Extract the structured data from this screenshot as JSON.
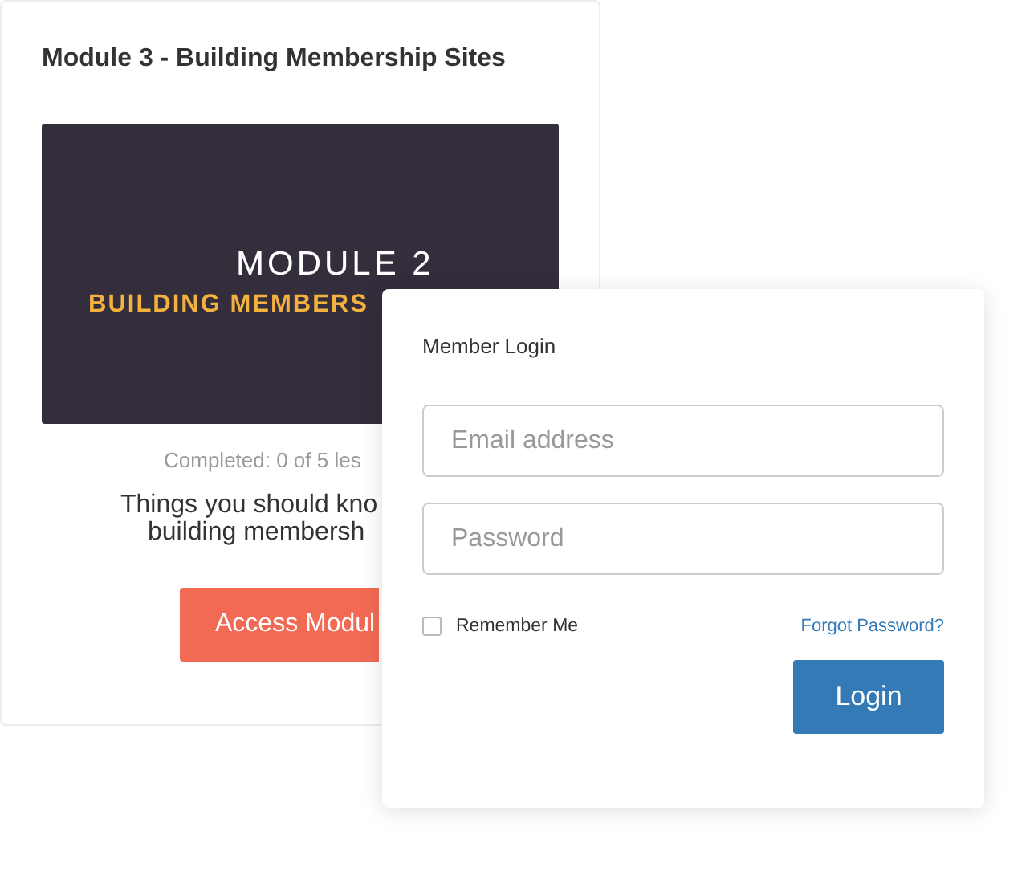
{
  "module_card": {
    "title": "Module 3 - Building Membership Sites",
    "banner": {
      "line_1": "MODULE 2",
      "line_2": "BUILDING MEMBERS"
    },
    "progress": "Completed: 0 of 5 les",
    "description": [
      "Things you should kno",
      "building membersh"
    ],
    "button": "Access Modul"
  },
  "login": {
    "title": "Member Login",
    "email": {
      "placeholder": "Email address"
    },
    "password": {
      "placeholder": "Password"
    },
    "remember": {
      "label": "Remember Me",
      "checked": false
    },
    "forgot_link": "Forgot Password?",
    "button": "Login"
  }
}
